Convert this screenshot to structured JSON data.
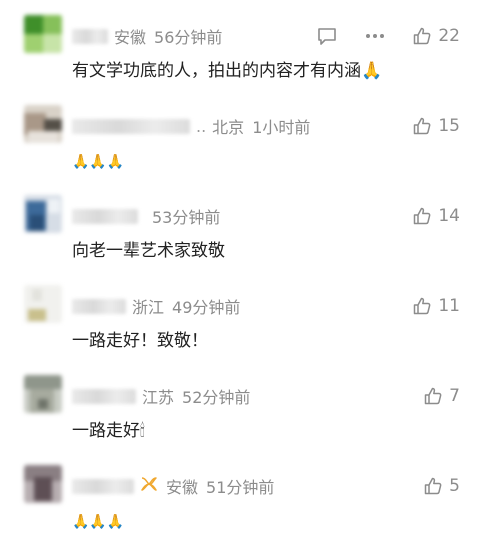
{
  "comments": [
    {
      "location": "安徽",
      "time": "56分钟前",
      "text": "有文学功底的人，拍出的内容才有内涵🙏",
      "likes": "22",
      "has_reply_icon": true,
      "has_more_icon": true
    },
    {
      "location": "北京",
      "time": "1小时前",
      "text": "🙏🙏🙏",
      "likes": "15",
      "nick_suffix": ".."
    },
    {
      "location": "",
      "time": "53分钟前",
      "text": "向老一辈艺术家致敬",
      "likes": "14"
    },
    {
      "location": "浙江",
      "time": "49分钟前",
      "text": "一路走好！致敬！",
      "likes": "11"
    },
    {
      "location": "江苏",
      "time": "52分钟前",
      "text": "一路走好🕯",
      "likes": "7"
    },
    {
      "location": "安徽",
      "time": "51分钟前",
      "text": "🙏🙏🙏",
      "likes": "5",
      "badge_icon": "ribbon-badge-icon"
    }
  ],
  "icons": {
    "reply": "comment-reply-icon",
    "more": "more-options-icon",
    "like": "thumbs-up-icon"
  },
  "colors": {
    "meta_text": "#8c8c8c",
    "comment_text": "#222222",
    "badge": "#f0a830"
  }
}
